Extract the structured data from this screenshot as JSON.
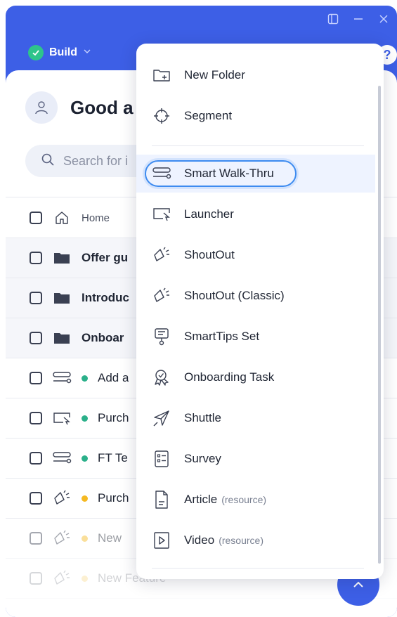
{
  "header": {
    "build_label": "Build",
    "help_label": "?"
  },
  "greeting": {
    "text": "Good a"
  },
  "search": {
    "placeholder": "Search for i"
  },
  "list": {
    "home_label": "Home",
    "rows": [
      {
        "label": "Offer gu",
        "type": "folder"
      },
      {
        "label": "Introduc",
        "type": "folder"
      },
      {
        "label": "Onboar",
        "type": "folder"
      },
      {
        "label": "Add a",
        "type": "smart-walk-thru",
        "status": "#2bb08a"
      },
      {
        "label": "Purch",
        "type": "launcher",
        "status": "#2bb08a"
      },
      {
        "label": "FT Te",
        "type": "smart-walk-thru",
        "status": "#2bb08a"
      },
      {
        "label": "Purch",
        "type": "shoutout",
        "status": "#f5b922"
      },
      {
        "label": "New",
        "type": "shoutout",
        "status": "#f5b922"
      },
      {
        "label": "New Feature",
        "type": "shoutout",
        "status": "#f5b922"
      }
    ]
  },
  "menu": {
    "items": [
      {
        "label": "New Folder",
        "suffix": "",
        "icon": "new-folder-icon"
      },
      {
        "label": "Segment",
        "suffix": "",
        "icon": "segment-icon"
      },
      {
        "label": "Smart Walk-Thru",
        "suffix": "",
        "icon": "smart-walk-thru-icon"
      },
      {
        "label": "Launcher",
        "suffix": "",
        "icon": "launcher-icon"
      },
      {
        "label": "ShoutOut",
        "suffix": "",
        "icon": "shoutout-icon"
      },
      {
        "label": "ShoutOut (Classic)",
        "suffix": "",
        "icon": "shoutout-classic-icon"
      },
      {
        "label": "SmartTips Set",
        "suffix": "",
        "icon": "smarttips-icon"
      },
      {
        "label": "Onboarding Task",
        "suffix": "",
        "icon": "onboarding-task-icon"
      },
      {
        "label": "Shuttle",
        "suffix": "",
        "icon": "shuttle-icon"
      },
      {
        "label": "Survey",
        "suffix": "",
        "icon": "survey-icon"
      },
      {
        "label": "Article",
        "suffix": "(resource)",
        "icon": "article-icon"
      },
      {
        "label": "Video",
        "suffix": "(resource)",
        "icon": "video-icon"
      }
    ]
  },
  "colors": {
    "brand": "#3d5fe6",
    "active": "#2ec48b",
    "draft": "#f5b922"
  }
}
